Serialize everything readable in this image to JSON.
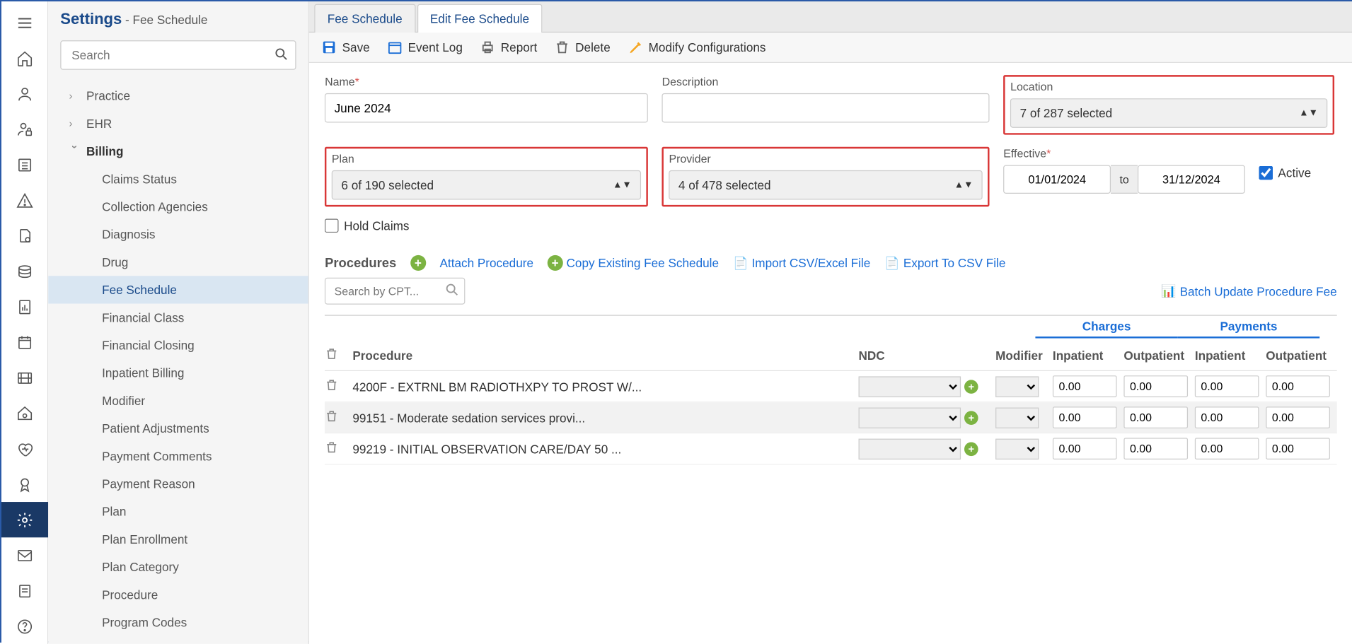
{
  "header": {
    "title": "Settings",
    "subtitle": " - Fee Schedule"
  },
  "search": {
    "placeholder": "Search"
  },
  "nav": {
    "practice": "Practice",
    "ehr": "EHR",
    "billing": "Billing",
    "items": [
      "Claims Status",
      "Collection Agencies",
      "Diagnosis",
      "Drug",
      "Fee Schedule",
      "Financial Class",
      "Financial Closing",
      "Inpatient Billing",
      "Modifier",
      "Patient Adjustments",
      "Payment Comments",
      "Payment Reason",
      "Plan",
      "Plan Enrollment",
      "Plan Category",
      "Procedure",
      "Program Codes"
    ],
    "selected": "Fee Schedule"
  },
  "tabs": {
    "t1": "Fee Schedule",
    "t2": "Edit Fee Schedule"
  },
  "toolbar": {
    "save": "Save",
    "eventlog": "Event Log",
    "report": "Report",
    "delete": "Delete",
    "modify": "Modify Configurations"
  },
  "form": {
    "name_label": "Name",
    "name_value": "June 2024",
    "desc_label": "Description",
    "desc_value": "",
    "location_label": "Location",
    "location_value": "7 of 287 selected",
    "plan_label": "Plan",
    "plan_value": "6 of 190 selected",
    "provider_label": "Provider",
    "provider_value": "4 of 478 selected",
    "effective_label": "Effective",
    "eff_from": "01/01/2024",
    "eff_to_label": "to",
    "eff_to": "31/12/2024",
    "active_label": "Active",
    "hold_label": "Hold Claims"
  },
  "procedures": {
    "title": "Procedures",
    "attach": "Attach Procedure",
    "copy": "Copy Existing Fee Schedule",
    "import": "Import CSV/Excel File",
    "export": "Export To CSV File",
    "search_placeholder": "Search by CPT...",
    "batch": "Batch Update Procedure Fee",
    "charges": "Charges",
    "payments": "Payments",
    "cols": {
      "proc": "Procedure",
      "ndc": "NDC",
      "mod": "Modifier",
      "inp": "Inpatient",
      "out": "Outpatient"
    },
    "rows": [
      {
        "proc": "4200F - EXTRNL BM RADIOTHXPY TO PROST W/...",
        "inp_c": "0.00",
        "out_c": "0.00",
        "inp_p": "0.00",
        "out_p": "0.00"
      },
      {
        "proc": "99151 - Moderate sedation services provi...",
        "inp_c": "0.00",
        "out_c": "0.00",
        "inp_p": "0.00",
        "out_p": "0.00"
      },
      {
        "proc": "99219 - INITIAL OBSERVATION CARE/DAY 50 ...",
        "inp_c": "0.00",
        "out_c": "0.00",
        "inp_p": "0.00",
        "out_p": "0.00"
      }
    ]
  }
}
